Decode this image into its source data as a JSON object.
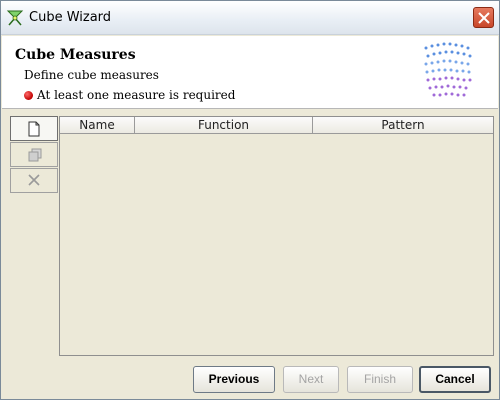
{
  "window": {
    "title": "Cube Wizard",
    "icons": {
      "app": "cube-wizard-icon",
      "close": "close-icon"
    }
  },
  "header": {
    "title": "Cube Measures",
    "description": "Define cube measures",
    "error_message": "At least one measure is required",
    "error_color": "#c00000",
    "logo": "cube-logo"
  },
  "toolbar": {
    "items": [
      {
        "icon": "new-document-icon",
        "state": "enabled"
      },
      {
        "icon": "copy-icon",
        "state": "disabled"
      },
      {
        "icon": "delete-icon",
        "state": "disabled"
      }
    ]
  },
  "table": {
    "columns": [
      "Name",
      "Function",
      "Pattern"
    ],
    "rows": []
  },
  "buttons": {
    "previous": "Previous",
    "next": "Next",
    "finish": "Finish",
    "cancel": "Cancel"
  }
}
